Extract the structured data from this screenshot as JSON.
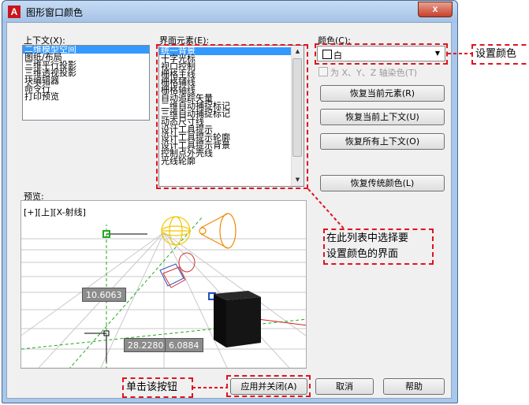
{
  "window": {
    "title": "图形窗口颜色",
    "logo_text": "A",
    "close_glyph": "x"
  },
  "context": {
    "label": "上下文(X):",
    "items": [
      "二维模型空间",
      "图纸/布局",
      "三维平行投影",
      "三维透视投影",
      "块编辑器",
      "命令行",
      "打印预览"
    ],
    "selected_index": 0
  },
  "interface": {
    "label": "界面元素(E):",
    "items": [
      "统一背景",
      "十字光标",
      "视口控制",
      "栅格主线",
      "栅格辅线",
      "栅格轴线",
      "自动追踪矢量",
      "二维自动捕捉标记",
      "三维自动捕捉标记",
      "动态尺寸线",
      "设计工具提示",
      "设计工具提示轮廓",
      "设计工具提示背景",
      "控制点外壳线",
      "光线轮廓"
    ],
    "selected_index": 0
  },
  "color": {
    "label": "颜色(C):",
    "value": "白",
    "checkbox_label": "为 X、Y、Z 轴染色(T)"
  },
  "buttons": {
    "restore_element": "恢复当前元素(R)",
    "restore_context": "恢复当前上下文(U)",
    "restore_all": "恢复所有上下文(O)",
    "restore_classic": "恢复传统颜色(L)",
    "apply_close": "应用并关闭(A)",
    "cancel": "取消",
    "help": "帮助"
  },
  "preview": {
    "label": "预览:",
    "viewport_label": "[+][上][X-射线]",
    "dim_left": "10.6063",
    "dim_x": "28.2280",
    "dim_y": "6.0884"
  },
  "annotations": {
    "set_color": "设置颜色",
    "list_hint_line1": "在此列表中选择要",
    "list_hint_line2": "设置颜色的界面",
    "click_button": "单击该按钮"
  },
  "colors": {
    "callout": "#e0141e",
    "selection": "#3399ff",
    "app_logo": "#c8161d"
  }
}
